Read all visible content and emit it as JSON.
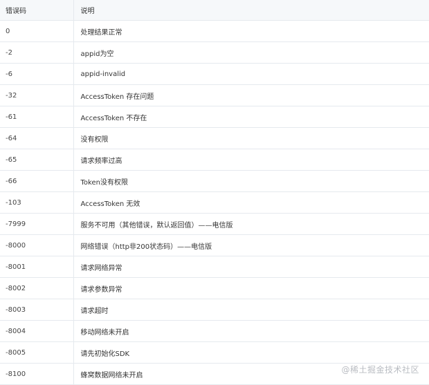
{
  "table": {
    "headers": [
      "错误码",
      "说明"
    ],
    "rows": [
      [
        "0",
        "处理结果正常"
      ],
      [
        "-2",
        "appid为空"
      ],
      [
        "-6",
        "appid-invalid"
      ],
      [
        "-32",
        "AccessToken 存在问题"
      ],
      [
        "-61",
        "AccessToken 不存在"
      ],
      [
        "-64",
        "没有权限"
      ],
      [
        "-65",
        "请求频率过高"
      ],
      [
        "-66",
        "Token没有权限"
      ],
      [
        "-103",
        "AccessToken 无效"
      ],
      [
        "-7999",
        "服务不可用（其他错误，默认返回值）——电信版"
      ],
      [
        "-8000",
        "网络错误（http非200状态码）——电信版"
      ],
      [
        "-8001",
        "请求网络异常"
      ],
      [
        "-8002",
        "请求参数异常"
      ],
      [
        "-8003",
        "请求超时"
      ],
      [
        "-8004",
        "移动网络未开启"
      ],
      [
        "-8005",
        "请先初始化SDK"
      ],
      [
        "-8100",
        "蜂窝数据网络未开启"
      ]
    ]
  },
  "watermark": "@稀土掘金技术社区"
}
